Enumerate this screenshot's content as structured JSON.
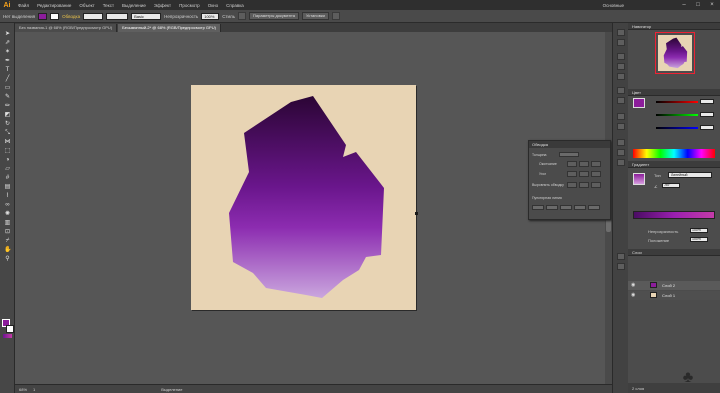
{
  "app": {
    "logo": "Ai",
    "workspace": "Основные",
    "minimize": "–",
    "maximize": "□",
    "close": "×"
  },
  "menu": [
    "Файл",
    "Редактирование",
    "Объект",
    "Текст",
    "Выделение",
    "Эффект",
    "Просмотр",
    "Окно",
    "Справка"
  ],
  "control_bar": {
    "selection_label": "Нет выделения",
    "stroke_label": "Обводка",
    "brush_value": "Basic",
    "style_field": "Основной",
    "opacity_label": "Непрозрачность",
    "opacity_value": "100%",
    "style_label": "Стиль",
    "doc_setup_button": "Параметры документа",
    "prefs_button": "Установки"
  },
  "tabs": [
    {
      "label": "Без названия-1 @ 68% (RGB/Предпросмотр GPU)",
      "active": false
    },
    {
      "label": "Безымянный-2* @ 68% (RGB/Предпросмотр GPU)",
      "active": true
    }
  ],
  "status": {
    "zoom": "68%",
    "page": "1",
    "tool": "Выделение"
  },
  "panels": {
    "navigator": "Навигатор",
    "color": "Цвет",
    "gradient": "Градиент",
    "transparency": "Обводка",
    "gradient_type_label": "Тип",
    "gradient_type_value": "Линейный",
    "angle_label": "∠",
    "angle_value": "-90°",
    "opacity_label": "Непрозрачность",
    "opacity_value": "100%",
    "location_label": "Положение",
    "location_value": "100%",
    "weight_label": "Толщина",
    "cap_label": "Окончание",
    "corner_label": "Угол",
    "align_label": "Выровнять обводку",
    "dashed_label": "Пунктирная линия",
    "layers": "Слои",
    "layer_count": "2 слоя"
  },
  "layers": [
    {
      "name": "Слой 2",
      "color": "#8c1d9b"
    },
    {
      "name": "Слой 1",
      "color": "#e8d4b4"
    }
  ],
  "colors": {
    "fill": "#8c1d9b",
    "gradient_top": "#33063f",
    "gradient_mid": "#6e1790",
    "gradient_bottom": "#c49bd8",
    "artboard": "#e8d4b4"
  }
}
